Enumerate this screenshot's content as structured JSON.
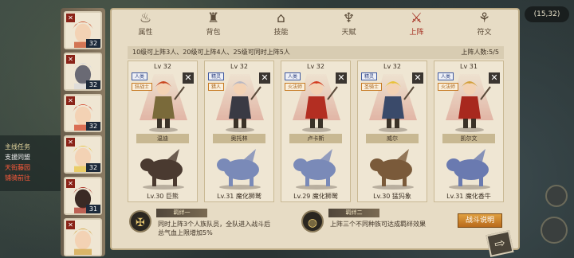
{
  "background": {
    "coords": "(15,32)",
    "quest_title": "主线任务",
    "quest_name": "支援同盟",
    "quest_line1": "天街藤园",
    "quest_line2": "铺骑前往"
  },
  "heroes": [
    {
      "level": "32",
      "marked": true
    },
    {
      "level": "32",
      "marked": true
    },
    {
      "level": "32",
      "marked": true
    },
    {
      "level": "32",
      "marked": true
    },
    {
      "level": "31",
      "marked": true
    },
    {
      "level": "",
      "marked": true
    }
  ],
  "hero_mark": "✕",
  "tabs": [
    {
      "label": "属性",
      "icon": "♨",
      "active": false
    },
    {
      "label": "背包",
      "icon": "♜",
      "active": false
    },
    {
      "label": "技能",
      "icon": "⌂",
      "active": false
    },
    {
      "label": "天赋",
      "icon": "♆",
      "active": false
    },
    {
      "label": "上阵",
      "icon": "⚔",
      "active": true
    },
    {
      "label": "符文",
      "icon": "⚘",
      "active": false
    }
  ],
  "info": {
    "rule": "10级可上阵3人、20级可上阵4人、25级可同时上阵5人",
    "count": "上阵人数:5/5"
  },
  "cards": [
    {
      "level": "Lv 32",
      "tags": [
        "人类",
        "狂战士"
      ],
      "name": "温迪",
      "mount": "Lv.30 巨熊",
      "colors": {
        "hair": "#c8441e",
        "body": "#7a6a3a"
      }
    },
    {
      "level": "Lv 32",
      "tags": [
        "精灵",
        "猎人"
      ],
      "name": "奥托林",
      "mount": "Lv.31 魔化狮鹫",
      "colors": {
        "hair": "#b8b8c4",
        "body": "#3a3a44"
      }
    },
    {
      "level": "Lv 32",
      "tags": [
        "人类",
        "火法师"
      ],
      "name": "卢卡斯",
      "mount": "Lv.29 魔化狮鹫",
      "colors": {
        "hair": "#d23a1e",
        "body": "#b32e22"
      }
    },
    {
      "level": "Lv 32",
      "tags": [
        "精灵",
        "圣骑士"
      ],
      "name": "威尔",
      "mount": "Lv.30 猛犸象",
      "colors": {
        "hair": "#e8c23a",
        "body": "#3a4a6a"
      }
    },
    {
      "level": "Lv 31",
      "tags": [
        "人类",
        "火法师"
      ],
      "name": "凯尔文",
      "mount": "Lv.31 魔化香牛",
      "colors": {
        "hair": "#d2a03a",
        "body": "#a8281e"
      }
    }
  ],
  "remove_label": "✕",
  "bonds": [
    {
      "title": "羁绊一",
      "text1": "同时上阵3个人族队员，全队进入战斗后",
      "text2": "总气血上限增加5%",
      "icon": "✠"
    },
    {
      "title": "羁绊二",
      "text1": "上阵三个不同种族可达成羁绊效果",
      "text2": "",
      "icon": "◍"
    }
  ],
  "battle_label": "战斗说明",
  "back_icon": "⇨"
}
